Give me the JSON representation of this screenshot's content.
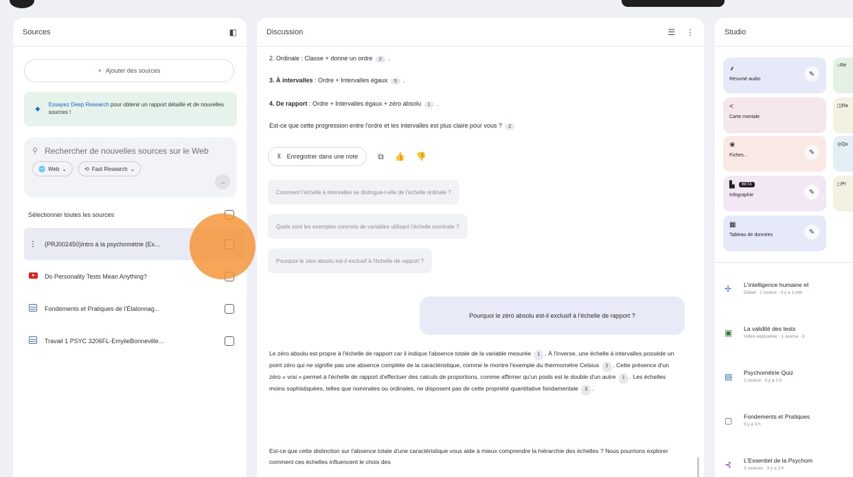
{
  "sources": {
    "title": "Sources",
    "add_label": "Ajouter des sources",
    "deep_link": "Essayez Deep Research",
    "deep_text": " pour obtenir un rapport détaillé et de nouvelles sources !",
    "search_placeholder": "Rechercher de nouvelles sources sur le Web",
    "chip_web": "Web",
    "chip_fast": "Fast Research",
    "select_all": "Sélectionner toutes les sources",
    "items": [
      {
        "name": "(PRJ002450)Intro à la psychométrie (Ex..."
      },
      {
        "name": "Do Personality Tests Mean Anything?"
      },
      {
        "name": "Fondements et Pratiques de l'Étalonnag..."
      },
      {
        "name": "Travail 1 PSYC 3206FL-EmylieBonneville..."
      }
    ]
  },
  "discussion": {
    "title": "Discussion",
    "cut_line": "2. Ordinale : Classe + donne un ordre",
    "cut_cite": "2",
    "line3_bold": "3. À intervalles",
    "line3_text": " : Ordre + Intervalles égaux ",
    "line3_cite": "5",
    "line4_bold": "4. De rapport",
    "line4_text": " : Ordre + Intervalles égaux + zéro absolu ",
    "line4_cite": "1",
    "question": "Est-ce que cette progression entre l'ordre et les intervalles est plus claire pour vous ? ",
    "question_cite": "2",
    "save_note": "Enregistrer dans une note",
    "suggestions": [
      "Comment l'échelle à intervalles se distingue-t-elle de l'échelle ordinale ?",
      "Quels sont les exemples concrets de variables utilisant l'échelle nominale ?",
      "Pourquoi le zéro absolu est-il exclusif à l'échelle de rapport ?"
    ],
    "user_message": "Pourquoi le zéro absolu est-il exclusif à l'échelle de rapport ?",
    "answer_p1": "Le zéro absolu est propre à l'échelle de rapport car il indique l'absence totale de la variable mesurée",
    "answer_c1": "1",
    "answer_p2": ". À l'inverse, une échelle à intervalles possède un point zéro qui ne signifie pas une absence complète de la caractéristique, comme le montre l'exemple du thermomètre Celsius",
    "answer_c2": "2",
    "answer_p3": ". Cette présence d'un zéro « vrai » permet à l'échelle de rapport d'effectuer des calculs de proportions, comme affirmer qu'un poids est le double d'un autre",
    "answer_c3": "1",
    "answer_p4": ". Les échelles moins sophistiquées, telles que nominales ou ordinales, ne disposent pas de cette propriété quantitative fondamentale",
    "answer_c4": "3",
    "answer2": "Est-ce que cette distinction sur l'absence totale d'une caractéristique vous aide à mieux comprendre la hiérarchie des échelles ? Nous pourrions explorer comment ces échelles influencent le choix des"
  },
  "studio": {
    "title": "Studio",
    "tiles": [
      {
        "label": "Résumé audio",
        "bg": "#e6e9f8"
      },
      {
        "label": "Carte mentale",
        "bg": "#f6e6ee"
      },
      {
        "label": "Fiches...",
        "bg": "#f9e8e4"
      },
      {
        "label": "Infographie",
        "bg": "#f3e6f5",
        "badge": "BETA"
      },
      {
        "label": "Tableau de données",
        "bg": "#e6e9f8"
      }
    ],
    "tiles_right": [
      {
        "label": "Ré",
        "bg": "#e3f1e4"
      },
      {
        "label": "Ra",
        "bg": "#f3f1e1"
      },
      {
        "label": "Qu",
        "bg": "#e2f0f6"
      },
      {
        "label": "Pr",
        "bg": "#f3f1e1"
      }
    ],
    "notes": [
      {
        "title": "L'intelligence humaine et",
        "sub": "Débat · 1 source · Il y a 1 min"
      },
      {
        "title": "La validité des tests",
        "sub": "Vidéo explicative · 1 source · Il"
      },
      {
        "title": "Psychométrie Quiz",
        "sub": "1 source · Il y a 3 h"
      },
      {
        "title": "Fondements et Pratiques",
        "sub": "Il y a 3 h"
      },
      {
        "title": "L'Essentiel de la Psychom",
        "sub": "3 sources · Il y a 3 h"
      }
    ]
  },
  "colors": {
    "accent_blue": "#1a5fd0",
    "highlight_orange": "#f59132",
    "youtube_red": "#e62117"
  }
}
